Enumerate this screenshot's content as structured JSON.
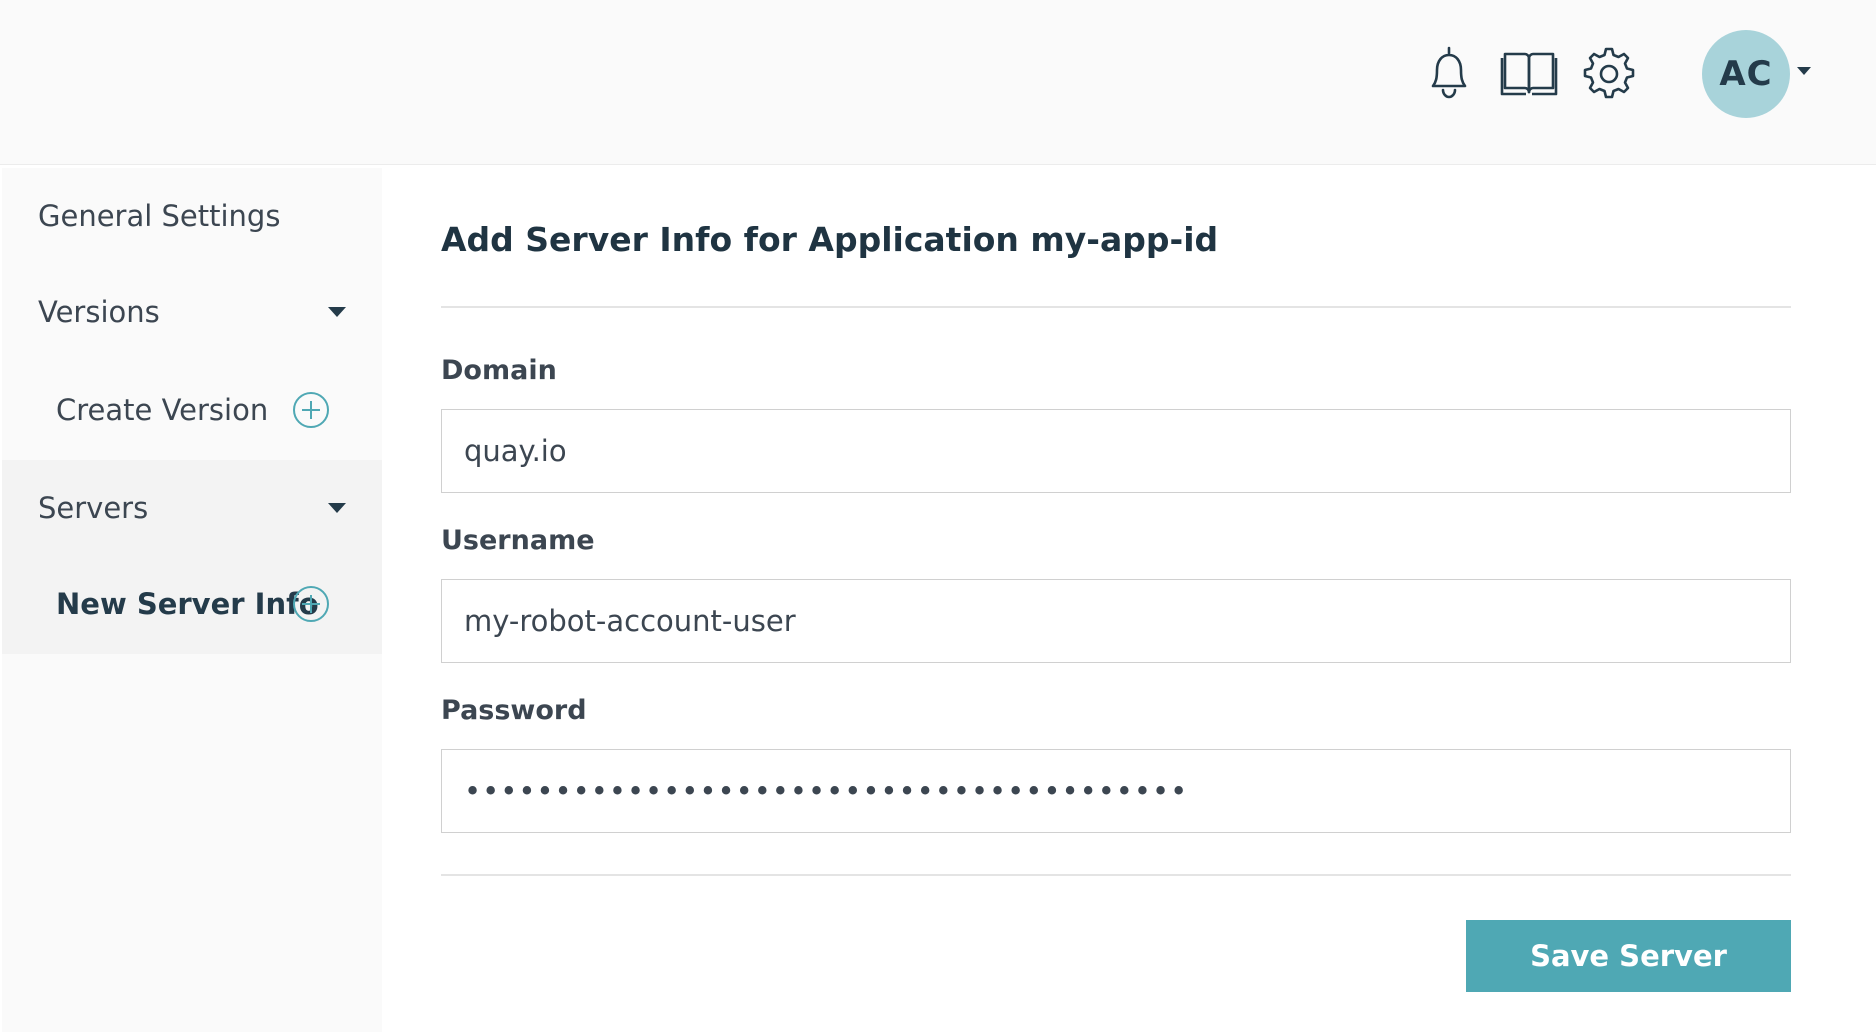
{
  "header": {
    "icons": [
      "bell-icon",
      "book-icon",
      "gear-icon"
    ],
    "avatar_initials": "AC"
  },
  "sidebar": {
    "general_settings": "General Settings",
    "versions": "Versions",
    "create_version": "Create Version",
    "servers": "Servers",
    "new_server_info": "New Server Info"
  },
  "main": {
    "title": "Add Server Info for Application my-app-id",
    "domain_label": "Domain",
    "domain_value": "quay.io",
    "username_label": "Username",
    "username_value": "my-robot-account-user",
    "password_label": "Password",
    "password_value": "••••••••••••••••••••••••••••••••••••••••",
    "save_button": "Save Server"
  },
  "colors": {
    "accent": "#4fa8b4",
    "avatar_bg": "#a8d3da",
    "title": "#1f3442"
  }
}
